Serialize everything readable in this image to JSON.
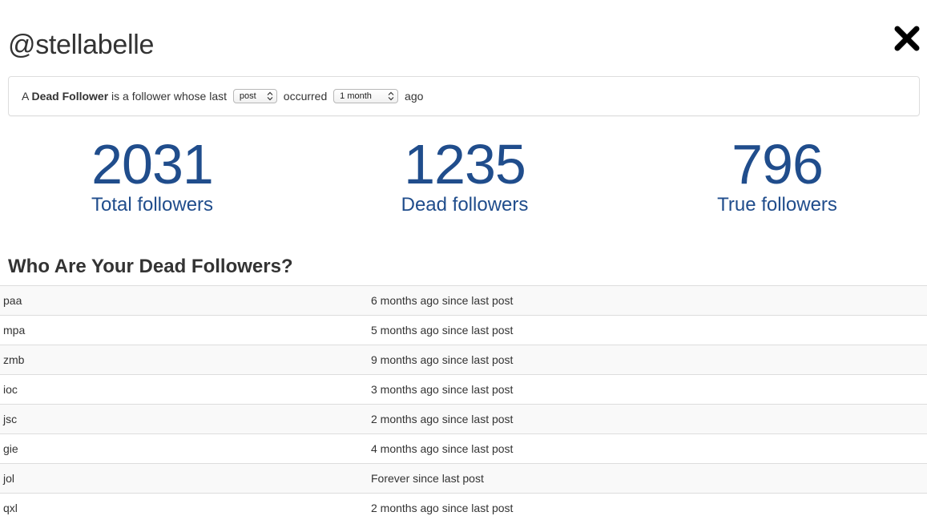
{
  "header": {
    "title": "@stellabelle",
    "close_icon": "close-x-icon"
  },
  "definition": {
    "prefix": "A ",
    "term": "Dead Follower",
    "middle": " is a follower whose last ",
    "activity_select": {
      "selected": "post",
      "options": [
        "post"
      ]
    },
    "occurred": " occurred ",
    "period_select": {
      "selected": "1 month",
      "options": [
        "1 month"
      ]
    },
    "suffix": " ago"
  },
  "stats": {
    "total": {
      "value": "2031",
      "label": "Total followers"
    },
    "dead": {
      "value": "1235",
      "label": "Dead followers"
    },
    "true": {
      "value": "796",
      "label": "True followers"
    }
  },
  "dead_list": {
    "heading": "Who Are Your Dead Followers?",
    "rows": [
      {
        "user": "paa",
        "since": "6 months ago since last post"
      },
      {
        "user": "mpa",
        "since": "5 months ago since last post"
      },
      {
        "user": "zmb",
        "since": "9 months ago since last post"
      },
      {
        "user": "ioc",
        "since": "3 months ago since last post"
      },
      {
        "user": "jsc",
        "since": "2 months ago since last post"
      },
      {
        "user": "gie",
        "since": "4 months ago since last post"
      },
      {
        "user": "jol",
        "since": "Forever since last post"
      },
      {
        "user": "qxl",
        "since": "2 months ago since last post"
      }
    ]
  },
  "colors": {
    "stat_blue": "#204d8c",
    "text": "#333333",
    "border": "#dddddd",
    "stripe": "#f9f9f9"
  }
}
